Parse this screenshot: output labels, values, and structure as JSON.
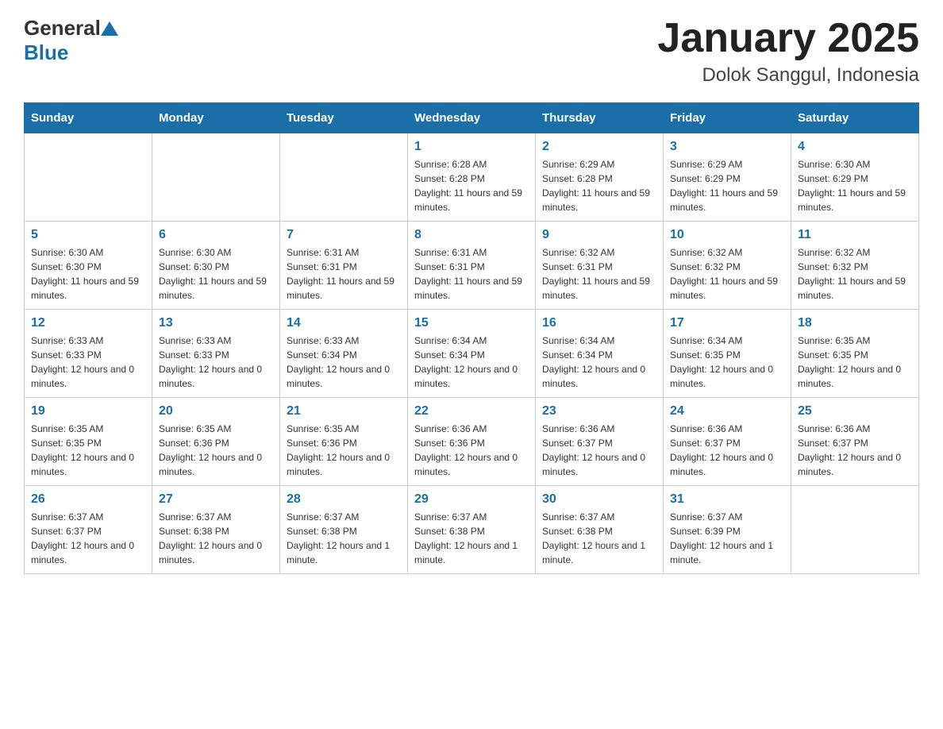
{
  "header": {
    "logo": {
      "general": "General",
      "blue": "Blue"
    },
    "title": "January 2025",
    "location": "Dolok Sanggul, Indonesia"
  },
  "weekdays": [
    "Sunday",
    "Monday",
    "Tuesday",
    "Wednesday",
    "Thursday",
    "Friday",
    "Saturday"
  ],
  "weeks": [
    [
      {
        "day": "",
        "info": ""
      },
      {
        "day": "",
        "info": ""
      },
      {
        "day": "",
        "info": ""
      },
      {
        "day": "1",
        "info": "Sunrise: 6:28 AM\nSunset: 6:28 PM\nDaylight: 11 hours and 59 minutes."
      },
      {
        "day": "2",
        "info": "Sunrise: 6:29 AM\nSunset: 6:28 PM\nDaylight: 11 hours and 59 minutes."
      },
      {
        "day": "3",
        "info": "Sunrise: 6:29 AM\nSunset: 6:29 PM\nDaylight: 11 hours and 59 minutes."
      },
      {
        "day": "4",
        "info": "Sunrise: 6:30 AM\nSunset: 6:29 PM\nDaylight: 11 hours and 59 minutes."
      }
    ],
    [
      {
        "day": "5",
        "info": "Sunrise: 6:30 AM\nSunset: 6:30 PM\nDaylight: 11 hours and 59 minutes."
      },
      {
        "day": "6",
        "info": "Sunrise: 6:30 AM\nSunset: 6:30 PM\nDaylight: 11 hours and 59 minutes."
      },
      {
        "day": "7",
        "info": "Sunrise: 6:31 AM\nSunset: 6:31 PM\nDaylight: 11 hours and 59 minutes."
      },
      {
        "day": "8",
        "info": "Sunrise: 6:31 AM\nSunset: 6:31 PM\nDaylight: 11 hours and 59 minutes."
      },
      {
        "day": "9",
        "info": "Sunrise: 6:32 AM\nSunset: 6:31 PM\nDaylight: 11 hours and 59 minutes."
      },
      {
        "day": "10",
        "info": "Sunrise: 6:32 AM\nSunset: 6:32 PM\nDaylight: 11 hours and 59 minutes."
      },
      {
        "day": "11",
        "info": "Sunrise: 6:32 AM\nSunset: 6:32 PM\nDaylight: 11 hours and 59 minutes."
      }
    ],
    [
      {
        "day": "12",
        "info": "Sunrise: 6:33 AM\nSunset: 6:33 PM\nDaylight: 12 hours and 0 minutes."
      },
      {
        "day": "13",
        "info": "Sunrise: 6:33 AM\nSunset: 6:33 PM\nDaylight: 12 hours and 0 minutes."
      },
      {
        "day": "14",
        "info": "Sunrise: 6:33 AM\nSunset: 6:34 PM\nDaylight: 12 hours and 0 minutes."
      },
      {
        "day": "15",
        "info": "Sunrise: 6:34 AM\nSunset: 6:34 PM\nDaylight: 12 hours and 0 minutes."
      },
      {
        "day": "16",
        "info": "Sunrise: 6:34 AM\nSunset: 6:34 PM\nDaylight: 12 hours and 0 minutes."
      },
      {
        "day": "17",
        "info": "Sunrise: 6:34 AM\nSunset: 6:35 PM\nDaylight: 12 hours and 0 minutes."
      },
      {
        "day": "18",
        "info": "Sunrise: 6:35 AM\nSunset: 6:35 PM\nDaylight: 12 hours and 0 minutes."
      }
    ],
    [
      {
        "day": "19",
        "info": "Sunrise: 6:35 AM\nSunset: 6:35 PM\nDaylight: 12 hours and 0 minutes."
      },
      {
        "day": "20",
        "info": "Sunrise: 6:35 AM\nSunset: 6:36 PM\nDaylight: 12 hours and 0 minutes."
      },
      {
        "day": "21",
        "info": "Sunrise: 6:35 AM\nSunset: 6:36 PM\nDaylight: 12 hours and 0 minutes."
      },
      {
        "day": "22",
        "info": "Sunrise: 6:36 AM\nSunset: 6:36 PM\nDaylight: 12 hours and 0 minutes."
      },
      {
        "day": "23",
        "info": "Sunrise: 6:36 AM\nSunset: 6:37 PM\nDaylight: 12 hours and 0 minutes."
      },
      {
        "day": "24",
        "info": "Sunrise: 6:36 AM\nSunset: 6:37 PM\nDaylight: 12 hours and 0 minutes."
      },
      {
        "day": "25",
        "info": "Sunrise: 6:36 AM\nSunset: 6:37 PM\nDaylight: 12 hours and 0 minutes."
      }
    ],
    [
      {
        "day": "26",
        "info": "Sunrise: 6:37 AM\nSunset: 6:37 PM\nDaylight: 12 hours and 0 minutes."
      },
      {
        "day": "27",
        "info": "Sunrise: 6:37 AM\nSunset: 6:38 PM\nDaylight: 12 hours and 0 minutes."
      },
      {
        "day": "28",
        "info": "Sunrise: 6:37 AM\nSunset: 6:38 PM\nDaylight: 12 hours and 1 minute."
      },
      {
        "day": "29",
        "info": "Sunrise: 6:37 AM\nSunset: 6:38 PM\nDaylight: 12 hours and 1 minute."
      },
      {
        "day": "30",
        "info": "Sunrise: 6:37 AM\nSunset: 6:38 PM\nDaylight: 12 hours and 1 minute."
      },
      {
        "day": "31",
        "info": "Sunrise: 6:37 AM\nSunset: 6:39 PM\nDaylight: 12 hours and 1 minute."
      },
      {
        "day": "",
        "info": ""
      }
    ]
  ]
}
